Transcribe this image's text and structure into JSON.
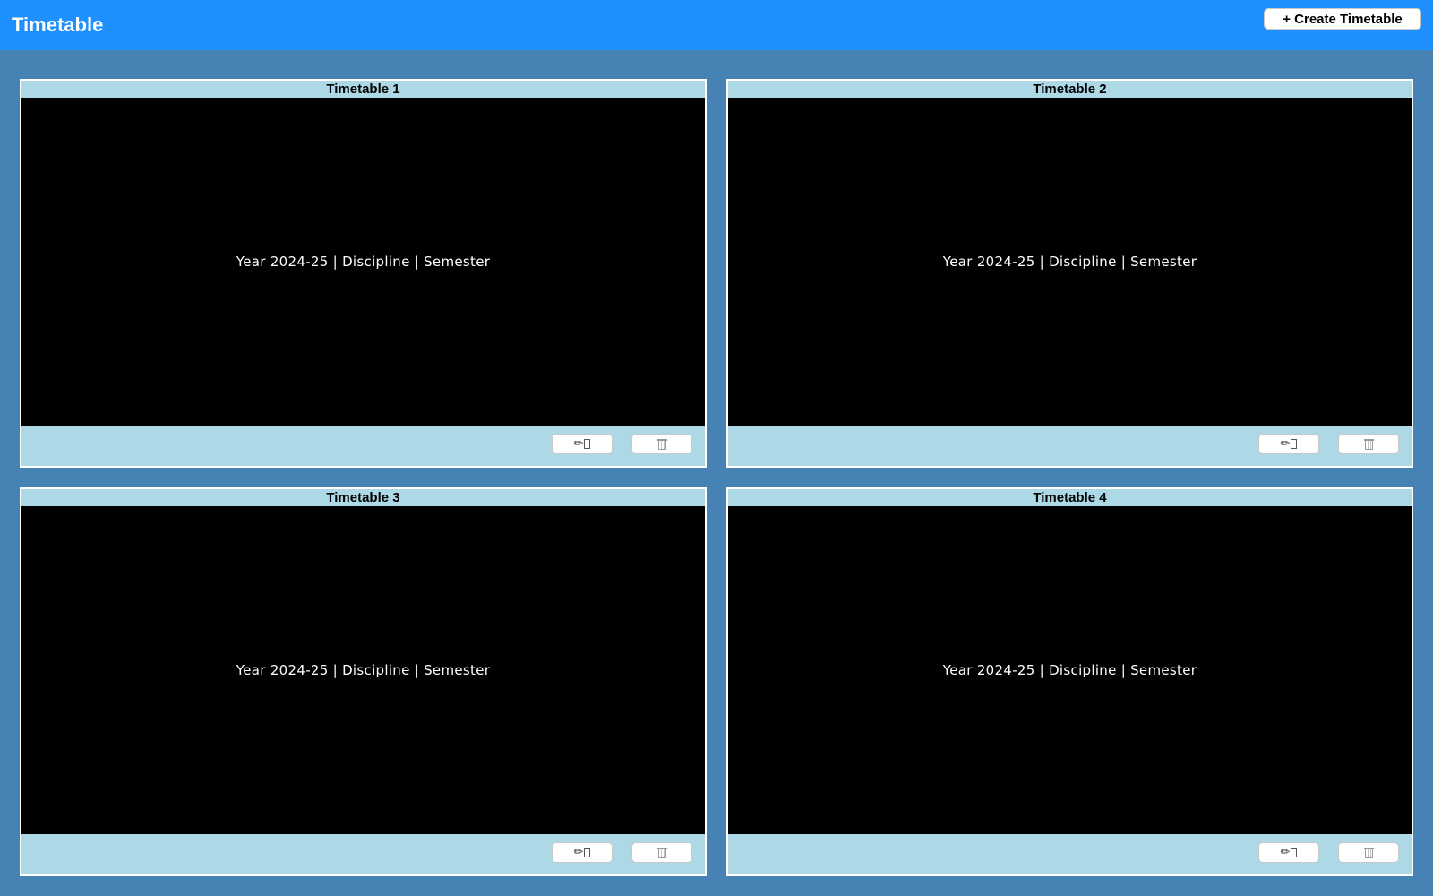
{
  "header": {
    "title": "Timetable",
    "create_button_label": "+ Create Timetable"
  },
  "timetables": [
    {
      "title": "Timetable 1",
      "info": "Year 2024-25 | Discipline | Semester",
      "edit_icon": "✏",
      "delete_icon": "trash-icon"
    },
    {
      "title": "Timetable 2",
      "info": "Year 2024-25 | Discipline | Semester",
      "edit_icon": "✏",
      "delete_icon": "trash-icon"
    },
    {
      "title": "Timetable 3",
      "info": "Year 2024-25 | Discipline | Semester",
      "edit_icon": "✏",
      "delete_icon": "trash-icon"
    },
    {
      "title": "Timetable 4",
      "info": "Year 2024-25 | Discipline | Semester",
      "edit_icon": "✏",
      "delete_icon": "trash-icon"
    }
  ],
  "colors": {
    "header_bg": "#1e90ff",
    "page_bg": "#4682b4",
    "card_bg": "#add8e6",
    "card_body_bg": "#000000"
  }
}
